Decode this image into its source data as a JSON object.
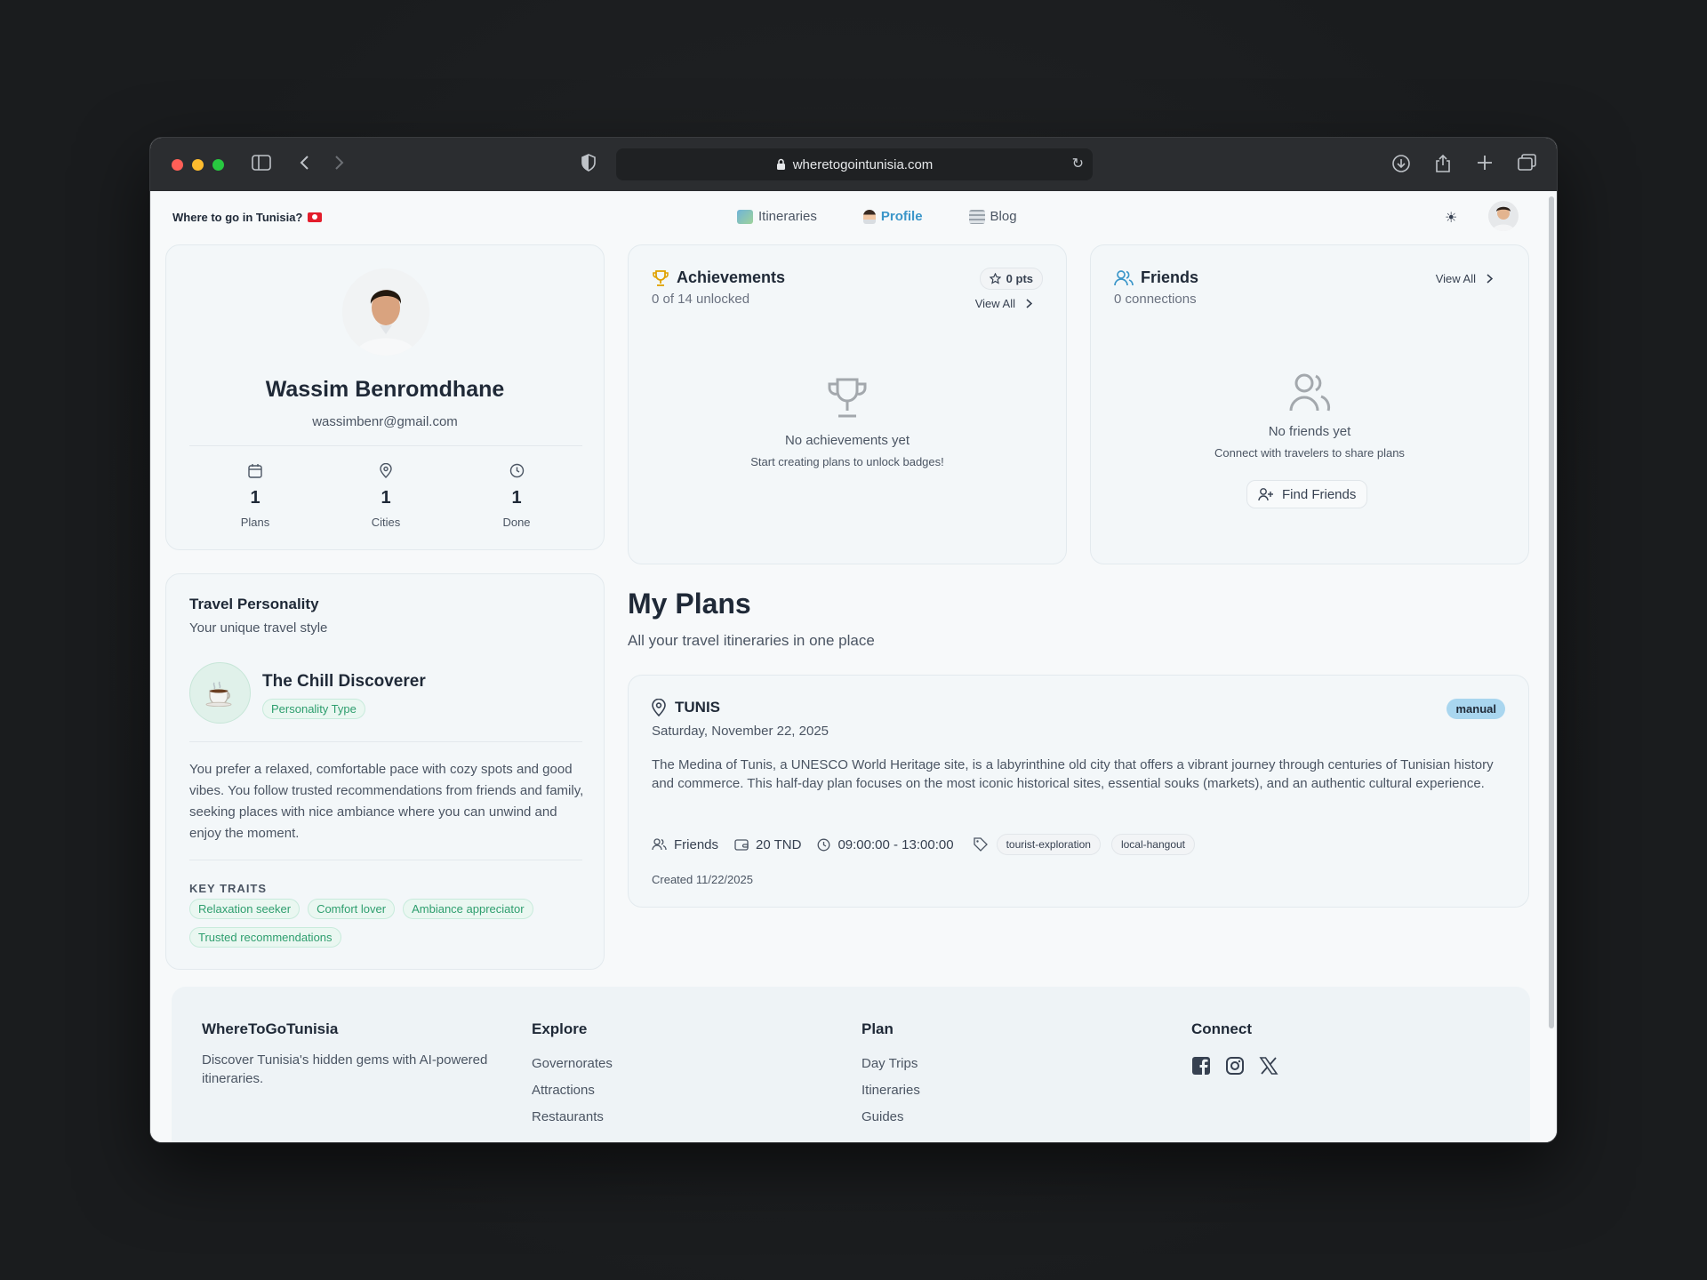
{
  "browser": {
    "url": "wheretogointunisia.com"
  },
  "nav": {
    "brand": "Where to go in Tunisia?",
    "links": [
      {
        "label": "Itineraries"
      },
      {
        "label": "Profile"
      },
      {
        "label": "Blog"
      }
    ]
  },
  "profile": {
    "name": "Wassim Benromdhane",
    "email": "wassimbenr@gmail.com",
    "stats": [
      {
        "value": "1",
        "label": "Plans",
        "icon": "calendar-icon"
      },
      {
        "value": "1",
        "label": "Cities",
        "icon": "map-pin-icon"
      },
      {
        "value": "1",
        "label": "Done",
        "icon": "clock-icon"
      }
    ]
  },
  "achievements": {
    "title": "Achievements",
    "subtitle": "0 of 14 unlocked",
    "points": "0 pts",
    "view_all": "View All",
    "empty_title": "No achievements yet",
    "empty_sub": "Start creating plans to unlock badges!"
  },
  "friends": {
    "title": "Friends",
    "subtitle": "0 connections",
    "view_all": "View All",
    "empty_title": "No friends yet",
    "empty_sub": "Connect with travelers to share plans",
    "find_button": "Find Friends"
  },
  "personality": {
    "title": "Travel Personality",
    "subtitle": "Your unique travel style",
    "type_name": "The Chill Discoverer",
    "type_tag": "Personality Type",
    "description": "You prefer a relaxed, comfortable pace with cozy spots and good vibes. You follow trusted recommendations from friends and family, seeking places with nice ambiance where you can unwind and enjoy the moment.",
    "traits_heading": "KEY TRAITS",
    "traits": [
      "Relaxation seeker",
      "Comfort lover",
      "Ambiance appreciator",
      "Trusted recommendations"
    ]
  },
  "plans": {
    "heading": "My Plans",
    "subheading": "All your travel itineraries in one place",
    "items": [
      {
        "city": "TUNIS",
        "date": "Saturday, November 22, 2025",
        "badge": "manual",
        "description": "The Medina of Tunis, a UNESCO World Heritage site, is a labyrinthine old city that offers a vibrant journey through centuries of Tunisian history and commerce. This half-day plan focuses on the most iconic historical sites, essential souks (markets), and an authentic cultural experience.",
        "group": "Friends",
        "budget": "20 TND",
        "time": "09:00:00 - 13:00:00",
        "tags": [
          "tourist-exploration",
          "local-hangout"
        ],
        "created": "Created 11/22/2025"
      }
    ]
  },
  "footer": {
    "brand": "WhereToGoTunisia",
    "tagline": "Discover Tunisia's hidden gems with AI-powered itineraries.",
    "explore": {
      "heading": "Explore",
      "links": [
        "Governorates",
        "Attractions",
        "Restaurants"
      ]
    },
    "plan": {
      "heading": "Plan",
      "links": [
        "Day Trips",
        "Itineraries",
        "Guides"
      ]
    },
    "connect": {
      "heading": "Connect",
      "icons": [
        "facebook-icon",
        "instagram-icon",
        "x-icon"
      ]
    }
  },
  "colors": {
    "accent": "#3b96c9",
    "tag_green": "#2e9e6e",
    "trophy_gold": "#e0a100",
    "manual_badge": "#a9d6ef"
  }
}
